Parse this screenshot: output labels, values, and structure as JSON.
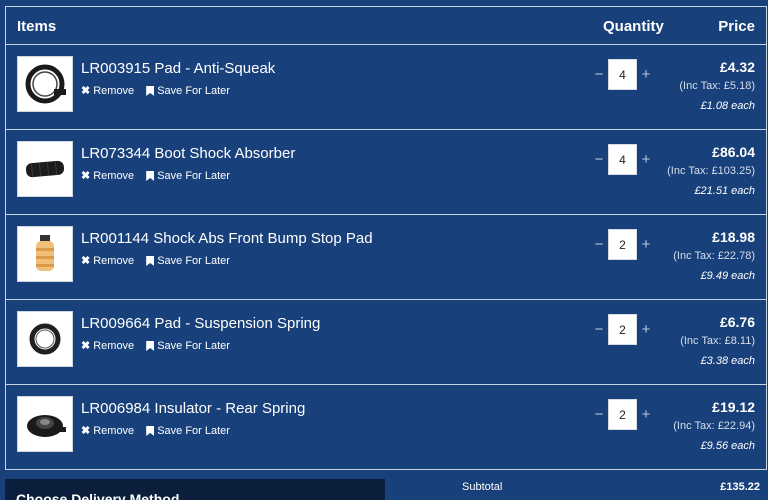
{
  "header": {
    "items": "Items",
    "quantity": "Quantity",
    "price": "Price"
  },
  "actions": {
    "remove": "Remove",
    "save": "Save For Later",
    "minus": "−",
    "plus": "+"
  },
  "items": [
    {
      "title": "LR003915 Pad - Anti-Squeak",
      "qty": "4",
      "price": "£4.32",
      "inc_tax": "(Inc Tax: £5.18)",
      "each": "£1.08 each",
      "icon": "ring-pad-icon"
    },
    {
      "title": "LR073344 Boot Shock Absorber",
      "qty": "4",
      "price": "£86.04",
      "inc_tax": "(Inc Tax: £103.25)",
      "each": "£21.51 each",
      "icon": "boot-tube-icon"
    },
    {
      "title": "LR001144 Shock Abs Front Bump Stop Pad",
      "qty": "2",
      "price": "£18.98",
      "inc_tax": "(Inc Tax: £22.78)",
      "each": "£9.49 each",
      "icon": "bump-stop-icon"
    },
    {
      "title": "LR009664 Pad - Suspension Spring",
      "qty": "2",
      "price": "£6.76",
      "inc_tax": "(Inc Tax: £8.11)",
      "each": "£3.38 each",
      "icon": "spring-pad-icon"
    },
    {
      "title": "LR006984 Insulator - Rear Spring",
      "qty": "2",
      "price": "£19.12",
      "inc_tax": "(Inc Tax: £22.94)",
      "each": "£9.56 each",
      "icon": "insulator-icon"
    }
  ],
  "delivery": {
    "title": "Choose Delivery Method"
  },
  "summary": {
    "subtotal_label": "Subtotal",
    "subtotal_value": "£135.22"
  },
  "colors": {
    "background": "#18407a",
    "border": "#c9d3e3",
    "delivery_panel": "#0b1f3d"
  }
}
